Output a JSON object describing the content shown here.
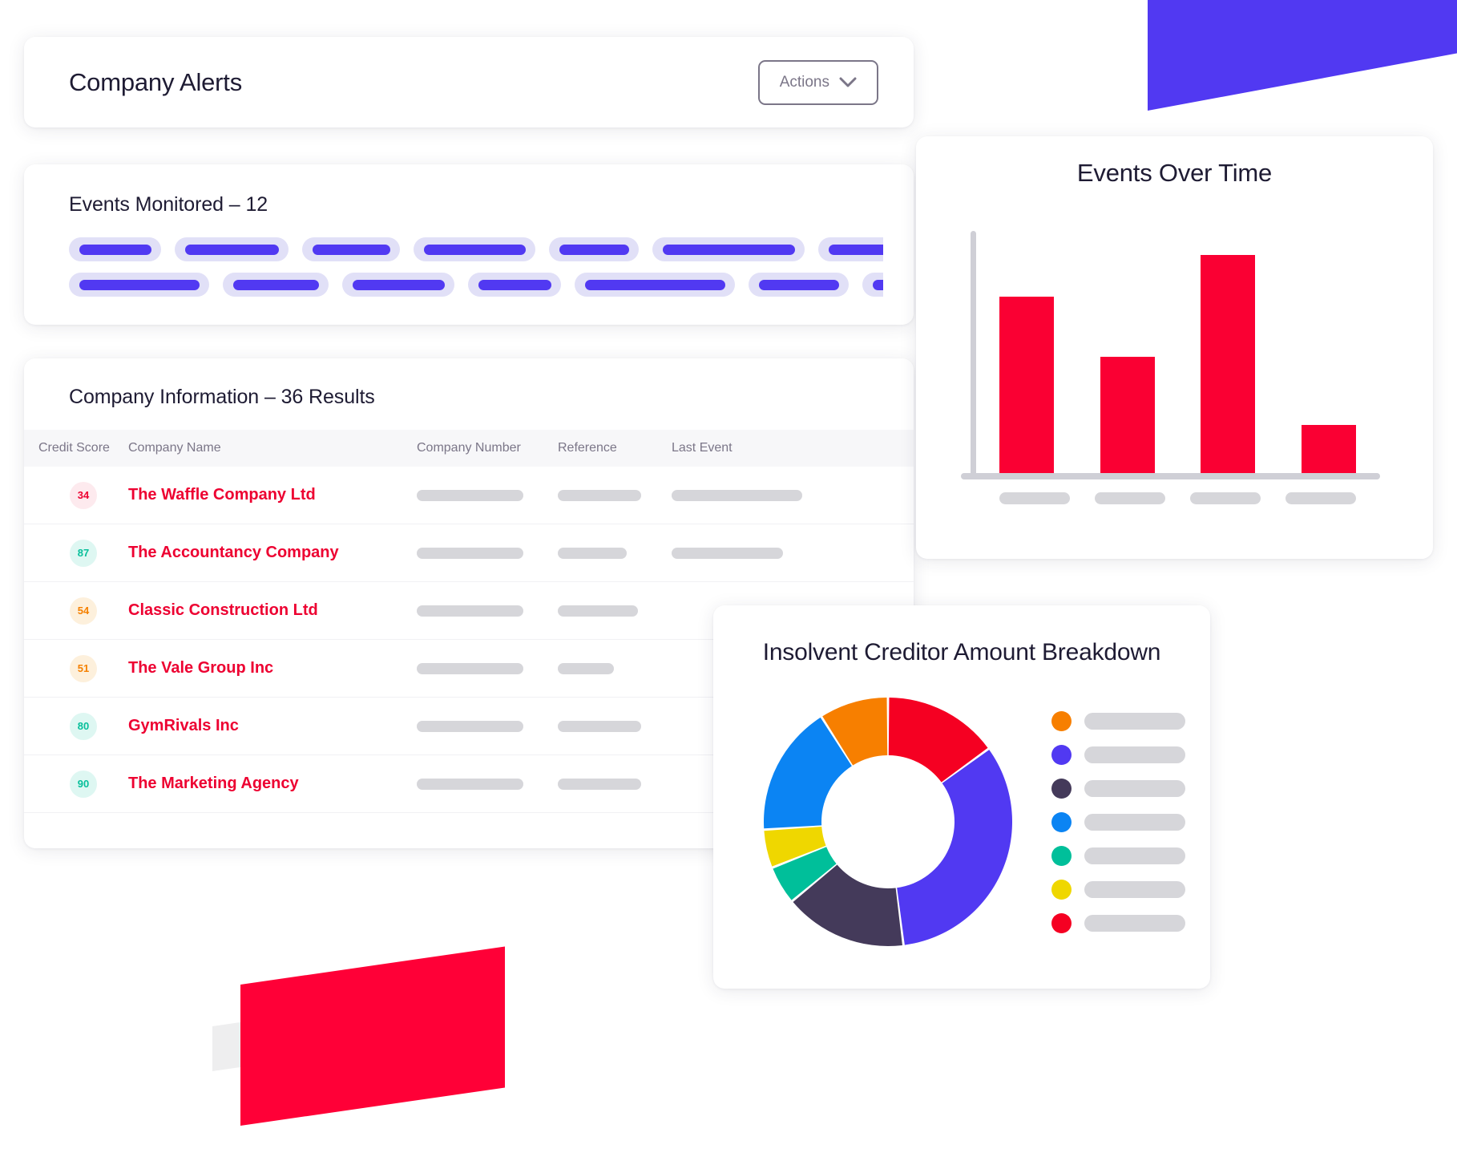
{
  "header": {
    "title": "Company Alerts",
    "actions_label": "Actions",
    "chevron_icon": "chevron-down-icon"
  },
  "events_monitored": {
    "title": "Events Monitored – 12",
    "skeleton_rows": [
      [
        {
          "outer": 115,
          "inner": 90
        },
        {
          "outer": 142,
          "inner": 117
        },
        {
          "outer": 122,
          "inner": 97
        },
        {
          "outer": 152,
          "inner": 127
        },
        {
          "outer": 112,
          "inner": 87
        },
        {
          "outer": 190,
          "inner": 165
        },
        {
          "outer": 130,
          "inner": 105
        }
      ],
      [
        {
          "outer": 175,
          "inner": 150
        },
        {
          "outer": 132,
          "inner": 107
        },
        {
          "outer": 140,
          "inner": 115
        },
        {
          "outer": 116,
          "inner": 91
        },
        {
          "outer": 200,
          "inner": 175
        },
        {
          "outer": 125,
          "inner": 100
        },
        {
          "outer": 110,
          "inner": 85
        }
      ]
    ]
  },
  "company_table": {
    "title": "Company Information – 36 Results",
    "columns": [
      "Credit Score",
      "Company Name",
      "Company Number",
      "Reference",
      "Last Event"
    ],
    "rows": [
      {
        "score": "34",
        "score_color": "#ed0131",
        "score_bg": "#fdeaee",
        "name": "The Waffle Company Ltd",
        "number_w": 133,
        "ref_w": 104,
        "event_w": 163
      },
      {
        "score": "87",
        "score_color": "#06bf9a",
        "score_bg": "#def7f2",
        "name": "The Accountancy Company",
        "number_w": 133,
        "ref_w": 86,
        "event_w": 139
      },
      {
        "score": "54",
        "score_color": "#f58000",
        "score_bg": "#fdf0dc",
        "name": "Classic Construction Ltd",
        "number_w": 133,
        "ref_w": 100,
        "event_w": 0
      },
      {
        "score": "51",
        "score_color": "#f58000",
        "score_bg": "#fdf0dc",
        "name": "The Vale Group Inc",
        "number_w": 133,
        "ref_w": 70,
        "event_w": 0
      },
      {
        "score": "80",
        "score_color": "#06bf9a",
        "score_bg": "#def7f2",
        "name": "GymRivals Inc",
        "number_w": 133,
        "ref_w": 104,
        "event_w": 0
      },
      {
        "score": "90",
        "score_color": "#06bf9a",
        "score_bg": "#def7f2",
        "name": "The Marketing Agency",
        "number_w": 133,
        "ref_w": 104,
        "event_w": 0
      }
    ]
  },
  "colors": {
    "accent_indigo": "#5139f2",
    "accent_red": "#ff0037",
    "bar_red": "#fa0033",
    "text_dark": "#1e1b33",
    "text_muted": "#7b7688",
    "skeleton_grey": "#d6d6da",
    "skeleton_lavender": "#e1e0f7"
  },
  "chart_data": [
    {
      "type": "bar",
      "title": "Events Over Time",
      "xlabel": "",
      "ylabel": "",
      "grid": false,
      "axis_visible": true,
      "categories": [
        "",
        "",
        "",
        ""
      ],
      "category_labels_hidden": true,
      "values": [
        73,
        48,
        90,
        20
      ],
      "ylim": [
        0,
        100
      ],
      "series_color": "#fa0033"
    },
    {
      "type": "pie",
      "donut": true,
      "title": "Insolvent Creditor Amount Breakdown",
      "legend_position": "right",
      "legend_labels_hidden": true,
      "slices": [
        {
          "label": "",
          "value": 15,
          "color": "#f50022"
        },
        {
          "label": "",
          "value": 33,
          "color": "#5139f2"
        },
        {
          "label": "",
          "value": 16,
          "color": "#443a5a"
        },
        {
          "label": "",
          "value": 5,
          "color": "#00bf9a"
        },
        {
          "label": "",
          "value": 5,
          "color": "#efd700"
        },
        {
          "label": "",
          "value": 17,
          "color": "#0b84f3"
        },
        {
          "label": "",
          "value": 9,
          "color": "#f77f00"
        }
      ],
      "legend_order_colors": [
        "#f77f00",
        "#5139f2",
        "#443a5a",
        "#0b84f3",
        "#00bf9a",
        "#efd700",
        "#f50022"
      ]
    }
  ]
}
